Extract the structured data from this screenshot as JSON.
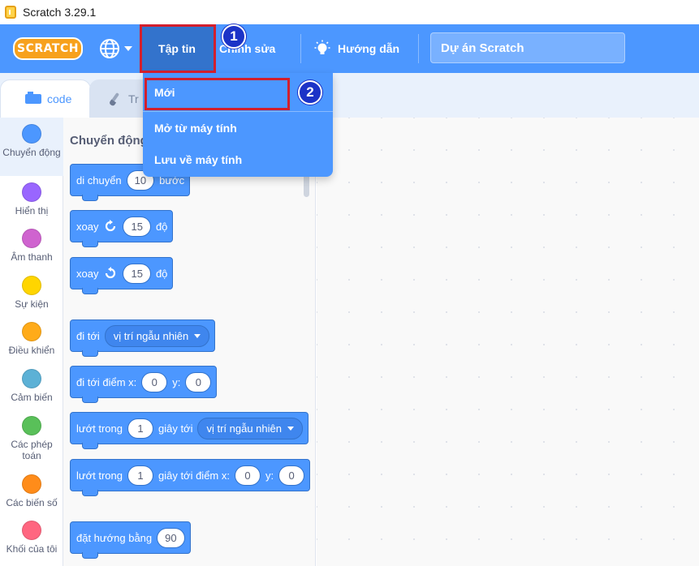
{
  "window": {
    "title": "Scratch 3.29.1"
  },
  "menubar": {
    "logo": "SCRATCH",
    "file": "Tập tin",
    "edit": "Chỉnh sửa",
    "tutorials": "Hướng dẫn",
    "project_title": "Dự án Scratch"
  },
  "file_menu": {
    "new": "Mới",
    "open": "Mở từ máy tính",
    "save": "Lưu về máy tính"
  },
  "callouts": {
    "one": "1",
    "two": "2"
  },
  "tabs": {
    "code": "code",
    "costumes": "Tr"
  },
  "categories": [
    {
      "label": "Chuyển động",
      "color": "#4c97ff"
    },
    {
      "label": "Hiển thị",
      "color": "#9966ff"
    },
    {
      "label": "Âm thanh",
      "color": "#cf63cf"
    },
    {
      "label": "Sự kiện",
      "color": "#ffd500"
    },
    {
      "label": "Điều khiển",
      "color": "#ffab19"
    },
    {
      "label": "Cảm biến",
      "color": "#5cb1d6"
    },
    {
      "label": "Các phép toán",
      "color": "#59c059"
    },
    {
      "label": "Các biến số",
      "color": "#ff8c1a"
    },
    {
      "label": "Khối của tôi",
      "color": "#ff6680"
    }
  ],
  "palette": {
    "heading": "Chuyển động",
    "move": {
      "text1": "di chuyển",
      "steps": "10",
      "text2": "bước"
    },
    "turn_right": {
      "text1": "xoay",
      "degrees": "15",
      "text2": "độ"
    },
    "turn_left": {
      "text1": "xoay",
      "degrees": "15",
      "text2": "độ"
    },
    "goto": {
      "text1": "đi tới",
      "target": "vị trí ngẫu nhiên"
    },
    "goto_xy": {
      "text1": "đi tới điểm x:",
      "x": "0",
      "ylabel": "y:",
      "y": "0"
    },
    "glide": {
      "text1": "lướt trong",
      "secs": "1",
      "text2": "giây tới",
      "target": "vị trí ngẫu nhiên"
    },
    "glide_xy": {
      "text1": "lướt trong",
      "secs": "1",
      "text2": "giây tới điểm x:",
      "x": "0",
      "ylabel": "y:",
      "y": "0"
    },
    "point": {
      "text1": "đặt hướng bằng",
      "dir": "90"
    }
  }
}
